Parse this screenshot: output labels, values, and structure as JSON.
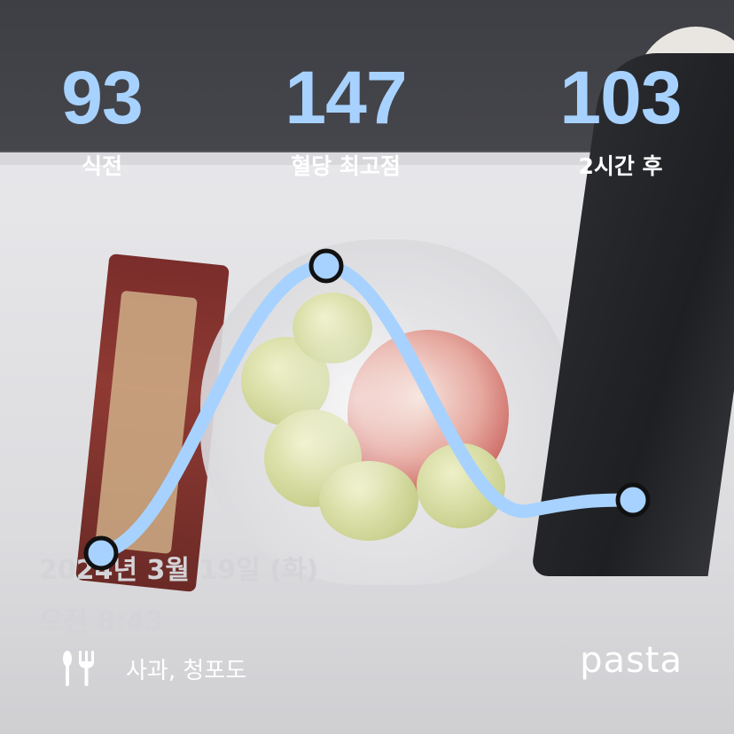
{
  "stats": {
    "before_meal": {
      "value": "93",
      "label": "식전"
    },
    "peak": {
      "value": "147",
      "label": "혈당 최고점"
    },
    "after_2h": {
      "value": "103",
      "label": "2시간 후"
    }
  },
  "glucose_points": [
    93,
    147,
    103
  ],
  "record": {
    "date": "2024년 3월 19일 (화)",
    "time": "오전 8:43",
    "food_icon": "fork-knife-icon",
    "foods": "사과, 청포도"
  },
  "brand": "pasta",
  "colors": {
    "accent": "#a7d2ff",
    "curve": "#a7d2ff",
    "marker_stroke": "#111111"
  }
}
